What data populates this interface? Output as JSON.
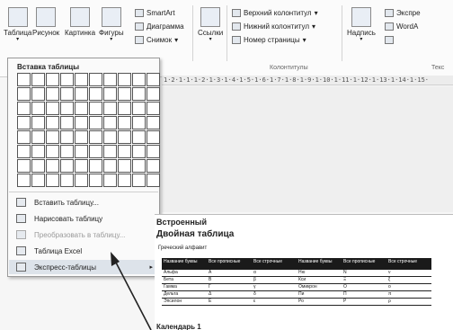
{
  "ribbon": {
    "buttons": [
      {
        "id": "table",
        "label": "Таблица"
      },
      {
        "id": "picture",
        "label": "Рисунок"
      },
      {
        "id": "clipart",
        "label": "Картинка"
      },
      {
        "id": "shapes",
        "label": "Фигуры"
      },
      {
        "id": "links",
        "label": "Ссылки"
      },
      {
        "id": "textbox",
        "label": "Надпись"
      }
    ],
    "small": {
      "smartart": "SmartArt",
      "diagram": "Диаграмма",
      "snapshot": "Снимок",
      "header": "Верхний колонтитул",
      "footer": "Нижний колонтитул",
      "page_number": "Номер страницы",
      "express": "Экспре",
      "wordart": "WordA"
    },
    "groups": {
      "header_footer": "Колонтитулы",
      "text": "Текс"
    }
  },
  "ruler": {
    "text": "1·2·1·1·1·2·1·3·1·4·1·5·1·6·1·7·1·8·1·9·1·10·1·11·1·12·1·13·1·14·1·15·"
  },
  "menu": {
    "title": "Вставка таблицы",
    "items": [
      {
        "label": "Вставить таблицу...",
        "icon": "insert-table-icon"
      },
      {
        "label": "Нарисовать таблицу",
        "icon": "pencil-icon"
      },
      {
        "label": "Преобразовать в таблицу...",
        "icon": "convert-table-icon"
      },
      {
        "label": "Таблица Excel",
        "icon": "excel-icon"
      },
      {
        "label": "Экспресс-таблицы",
        "icon": "quick-tables-icon"
      }
    ],
    "submenu_arrow": "▸"
  },
  "gallery": {
    "section": "Встроенный",
    "table_name": "Двойная таблица",
    "caption": "Греческий алфавит",
    "headers": [
      "Название буквы",
      "Все прописные",
      "Все строчные",
      "Название буквы",
      "Все прописные",
      "Все строчные"
    ],
    "rows": [
      [
        "Альфа",
        "Α",
        "α",
        "Ню",
        "Ν",
        "ν"
      ],
      [
        "Бета",
        "Β",
        "β",
        "Кси",
        "Ξ",
        "ξ"
      ],
      [
        "Гамма",
        "Γ",
        "γ",
        "Омикрон",
        "Ο",
        "ο"
      ],
      [
        "Дельта",
        "Δ",
        "δ",
        "Пи",
        "Π",
        "π"
      ],
      [
        "Эпсилон",
        "Ε",
        "ε",
        "Ро",
        "Ρ",
        "ρ"
      ]
    ],
    "next_item": "Календарь 1"
  },
  "colors": {
    "highlight": "#dde3ea",
    "table_header": "#1a1a1a"
  }
}
